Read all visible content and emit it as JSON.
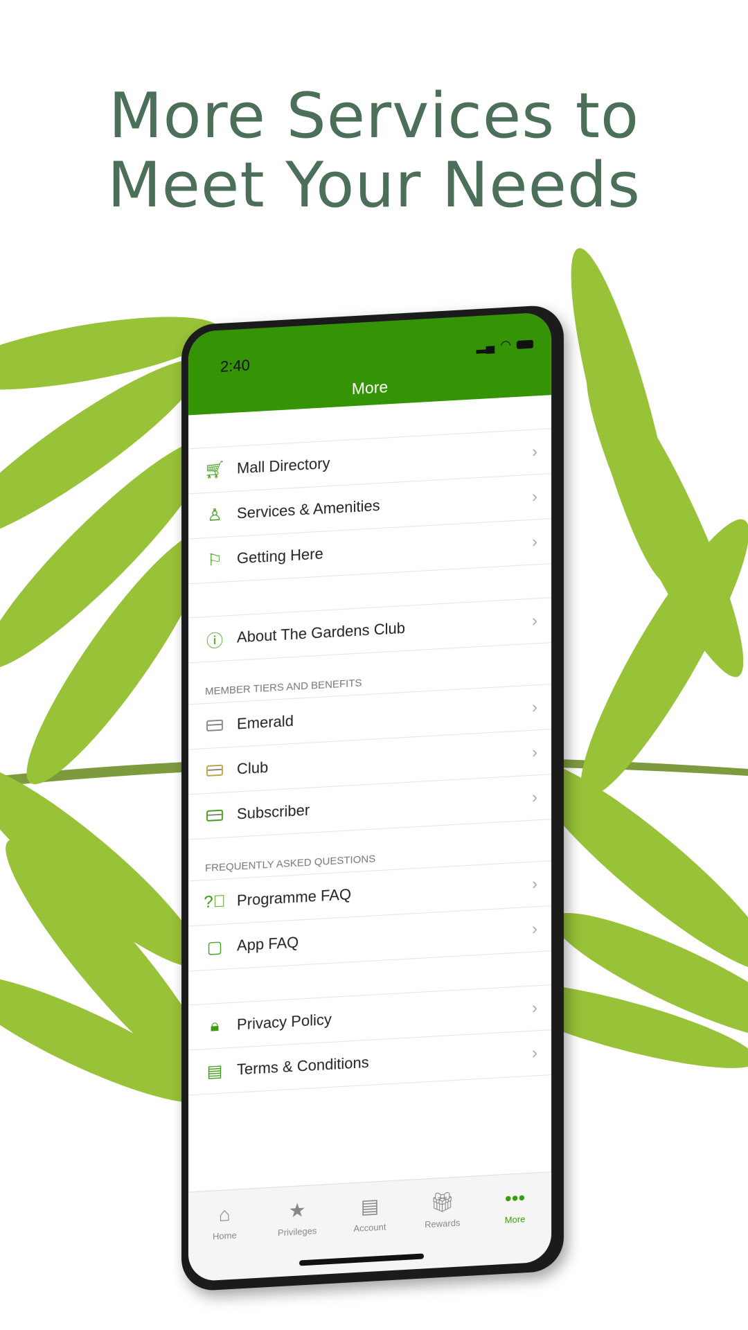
{
  "headline": {
    "line1": "More Services to",
    "line2": "Meet Your Needs"
  },
  "colors": {
    "headline": "#4b6f58",
    "brand_green": "#359405"
  },
  "status_bar": {
    "time": "2:40",
    "icons": [
      "signal-icon",
      "wifi-icon",
      "battery-icon"
    ]
  },
  "nav": {
    "title": "More"
  },
  "groups": [
    {
      "items": [
        {
          "label": "Mall Directory",
          "icon": "cart-icon"
        },
        {
          "label": "Services & Amenities",
          "icon": "hand-service-icon"
        },
        {
          "label": "Getting Here",
          "icon": "signpost-icon"
        }
      ]
    },
    {
      "items": [
        {
          "label": "About The Gardens Club",
          "icon": "info-icon"
        }
      ]
    },
    {
      "header": "MEMBER TIERS AND BENEFITS",
      "items": [
        {
          "label": "Emerald",
          "icon": "card-icon"
        },
        {
          "label": "Club",
          "icon": "card-icon"
        },
        {
          "label": "Subscriber",
          "icon": "card-icon"
        }
      ]
    },
    {
      "header": "FREQUENTLY ASKED QUESTIONS",
      "items": [
        {
          "label": "Programme FAQ",
          "icon": "question-icon"
        },
        {
          "label": "App FAQ",
          "icon": "square-icon"
        }
      ]
    },
    {
      "items": [
        {
          "label": "Privacy Policy",
          "icon": "lock-icon"
        },
        {
          "label": "Terms & Conditions",
          "icon": "document-icon"
        }
      ]
    }
  ],
  "tabs": [
    {
      "label": "Home",
      "icon": "home-icon"
    },
    {
      "label": "Privileges",
      "icon": "star-icon"
    },
    {
      "label": "Account",
      "icon": "wallet-icon"
    },
    {
      "label": "Rewards",
      "icon": "gift-icon"
    },
    {
      "label": "More",
      "icon": "more-dots-icon",
      "active": true
    }
  ]
}
